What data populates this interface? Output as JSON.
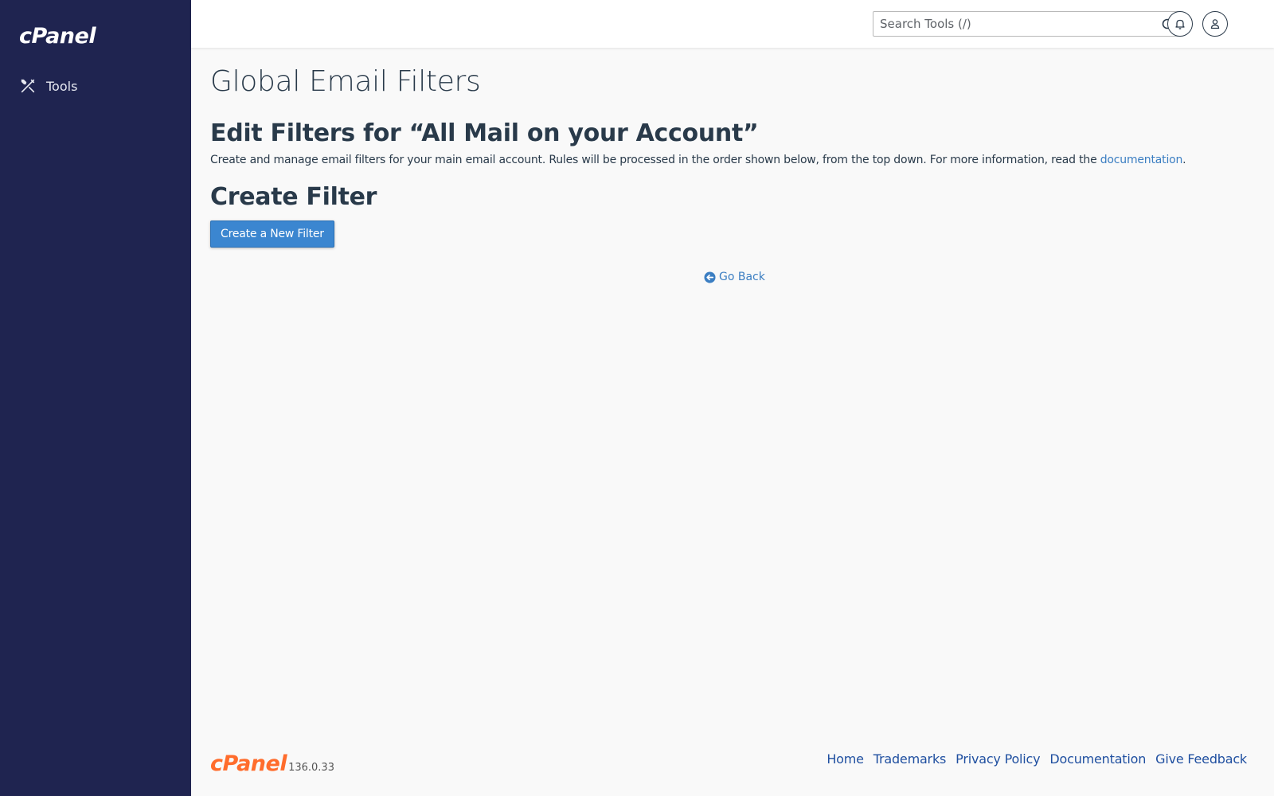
{
  "sidebar": {
    "logo": "cPanel",
    "items": [
      {
        "label": "Tools",
        "icon": "tools-icon"
      }
    ]
  },
  "header": {
    "search_placeholder": "Search Tools (/)",
    "icons": [
      "search-icon",
      "bell-icon",
      "user-icon"
    ]
  },
  "main": {
    "page_title": "Global Email Filters",
    "edit_heading": "Edit Filters for “All Mail on your Account”",
    "description": "Create and manage email filters for your main email account. Rules will be processed in the order shown below, from the top down. For more information, read the ",
    "description_link": "documentation",
    "description_end": ".",
    "create_heading": "Create Filter",
    "create_button": "Create a New Filter",
    "go_back": "Go Back"
  },
  "footer": {
    "logo": "cPanel",
    "version": "136.0.33",
    "links": [
      "Home",
      "Trademarks",
      "Privacy Policy",
      "Documentation",
      "Give Feedback"
    ]
  },
  "colors": {
    "sidebar_bg": "#1f2450",
    "primary_button": "#3b86d0",
    "link": "#3b7ec2",
    "footer_brand": "#ff6c2c"
  }
}
